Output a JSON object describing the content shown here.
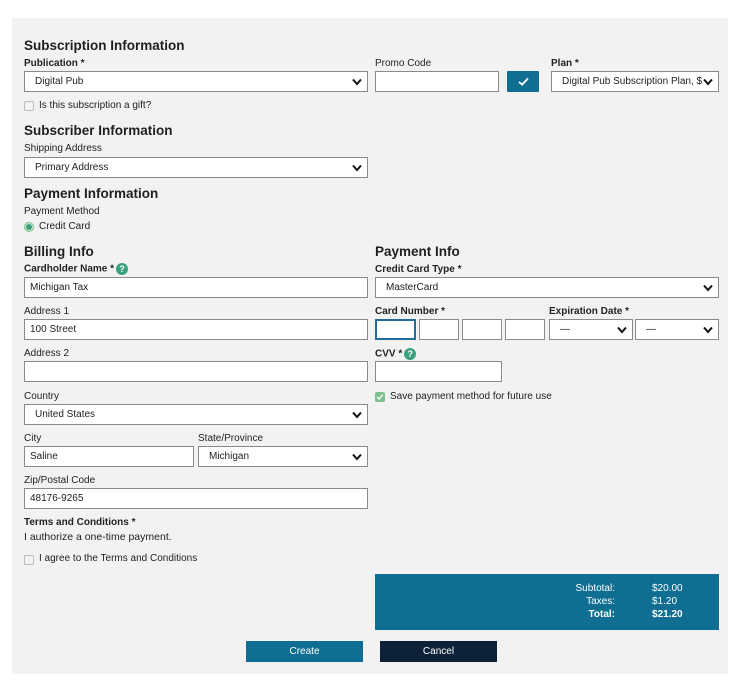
{
  "subscription": {
    "heading": "Subscription Information",
    "publication_label": "Publication *",
    "publication_value": "Digital Pub",
    "promo_label": "Promo Code",
    "promo_value": "",
    "apply_icon": "check-icon",
    "plan_label": "Plan *",
    "plan_value": "Digital Pub Subscription Plan, $",
    "gift_label": "Is this subscription a gift?"
  },
  "subscriber": {
    "heading": "Subscriber Information",
    "shipping_label": "Shipping Address",
    "shipping_value": "Primary Address"
  },
  "payment": {
    "heading": "Payment Information",
    "method_label": "Payment Method",
    "method_option": "Credit Card"
  },
  "billing": {
    "heading": "Billing Info",
    "cardholder_label": "Cardholder Name *",
    "cardholder_value": "Michigan Tax",
    "address1_label": "Address 1",
    "address1_value": "100 Street",
    "address2_label": "Address 2",
    "address2_value": "",
    "country_label": "Country",
    "country_value": "United States",
    "city_label": "City",
    "city_value": "Saline",
    "state_label": "State/Province",
    "state_value": "Michigan",
    "zip_label": "Zip/Postal Code",
    "zip_value": "48176-9265"
  },
  "payment_info": {
    "heading": "Payment Info",
    "card_type_label": "Credit Card Type *",
    "card_type_value": "MasterCard",
    "card_number_label": "Card Number *",
    "expiration_label": "Expiration Date *",
    "exp_month_value": "—",
    "exp_year_value": "—",
    "cvv_label": "CVV *",
    "save_label": "Save payment method for future use"
  },
  "terms": {
    "heading": "Terms and Conditions *",
    "text": "I authorize a one-time payment.",
    "agree_label": "I agree to the Terms and Conditions"
  },
  "summary": {
    "subtotal_label": "Subtotal:",
    "subtotal_value": "$20.00",
    "taxes_label": "Taxes:",
    "taxes_value": "$1.20",
    "total_label": "Total:",
    "total_value": "$21.20"
  },
  "actions": {
    "create_label": "Create",
    "cancel_label": "Cancel"
  },
  "colors": {
    "accent": "#0f6e92",
    "dark": "#0d2238",
    "panel": "#f2f2f2",
    "help": "#3aa07f",
    "check_on": "#7fbf8f"
  }
}
